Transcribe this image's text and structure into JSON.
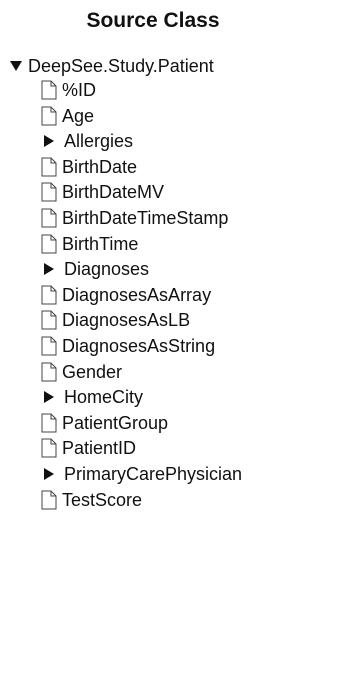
{
  "panel": {
    "title": "Source Class"
  },
  "tree": {
    "root": {
      "label": "DeepSee.Study.Patient",
      "expanded": true,
      "icon": "caret-down-icon"
    },
    "items": [
      {
        "label": "%ID",
        "type": "property",
        "icon": "document-icon"
      },
      {
        "label": "Age",
        "type": "property",
        "icon": "document-icon"
      },
      {
        "label": "Allergies",
        "type": "collapsed-node",
        "icon": "caret-right-icon"
      },
      {
        "label": "BirthDate",
        "type": "property",
        "icon": "document-icon"
      },
      {
        "label": "BirthDateMV",
        "type": "property",
        "icon": "document-icon"
      },
      {
        "label": "BirthDateTimeStamp",
        "type": "property",
        "icon": "document-icon"
      },
      {
        "label": "BirthTime",
        "type": "property",
        "icon": "document-icon"
      },
      {
        "label": "Diagnoses",
        "type": "collapsed-node",
        "icon": "caret-right-icon"
      },
      {
        "label": "DiagnosesAsArray",
        "type": "property",
        "icon": "document-icon"
      },
      {
        "label": "DiagnosesAsLB",
        "type": "property",
        "icon": "document-icon"
      },
      {
        "label": "DiagnosesAsString",
        "type": "property",
        "icon": "document-icon"
      },
      {
        "label": "Gender",
        "type": "property",
        "icon": "document-icon"
      },
      {
        "label": "HomeCity",
        "type": "collapsed-node",
        "icon": "caret-right-icon"
      },
      {
        "label": "PatientGroup",
        "type": "property",
        "icon": "document-icon"
      },
      {
        "label": "PatientID",
        "type": "property",
        "icon": "document-icon"
      },
      {
        "label": "PrimaryCarePhysician",
        "type": "collapsed-node",
        "icon": "caret-right-icon"
      },
      {
        "label": "TestScore",
        "type": "property",
        "icon": "document-icon"
      }
    ]
  }
}
